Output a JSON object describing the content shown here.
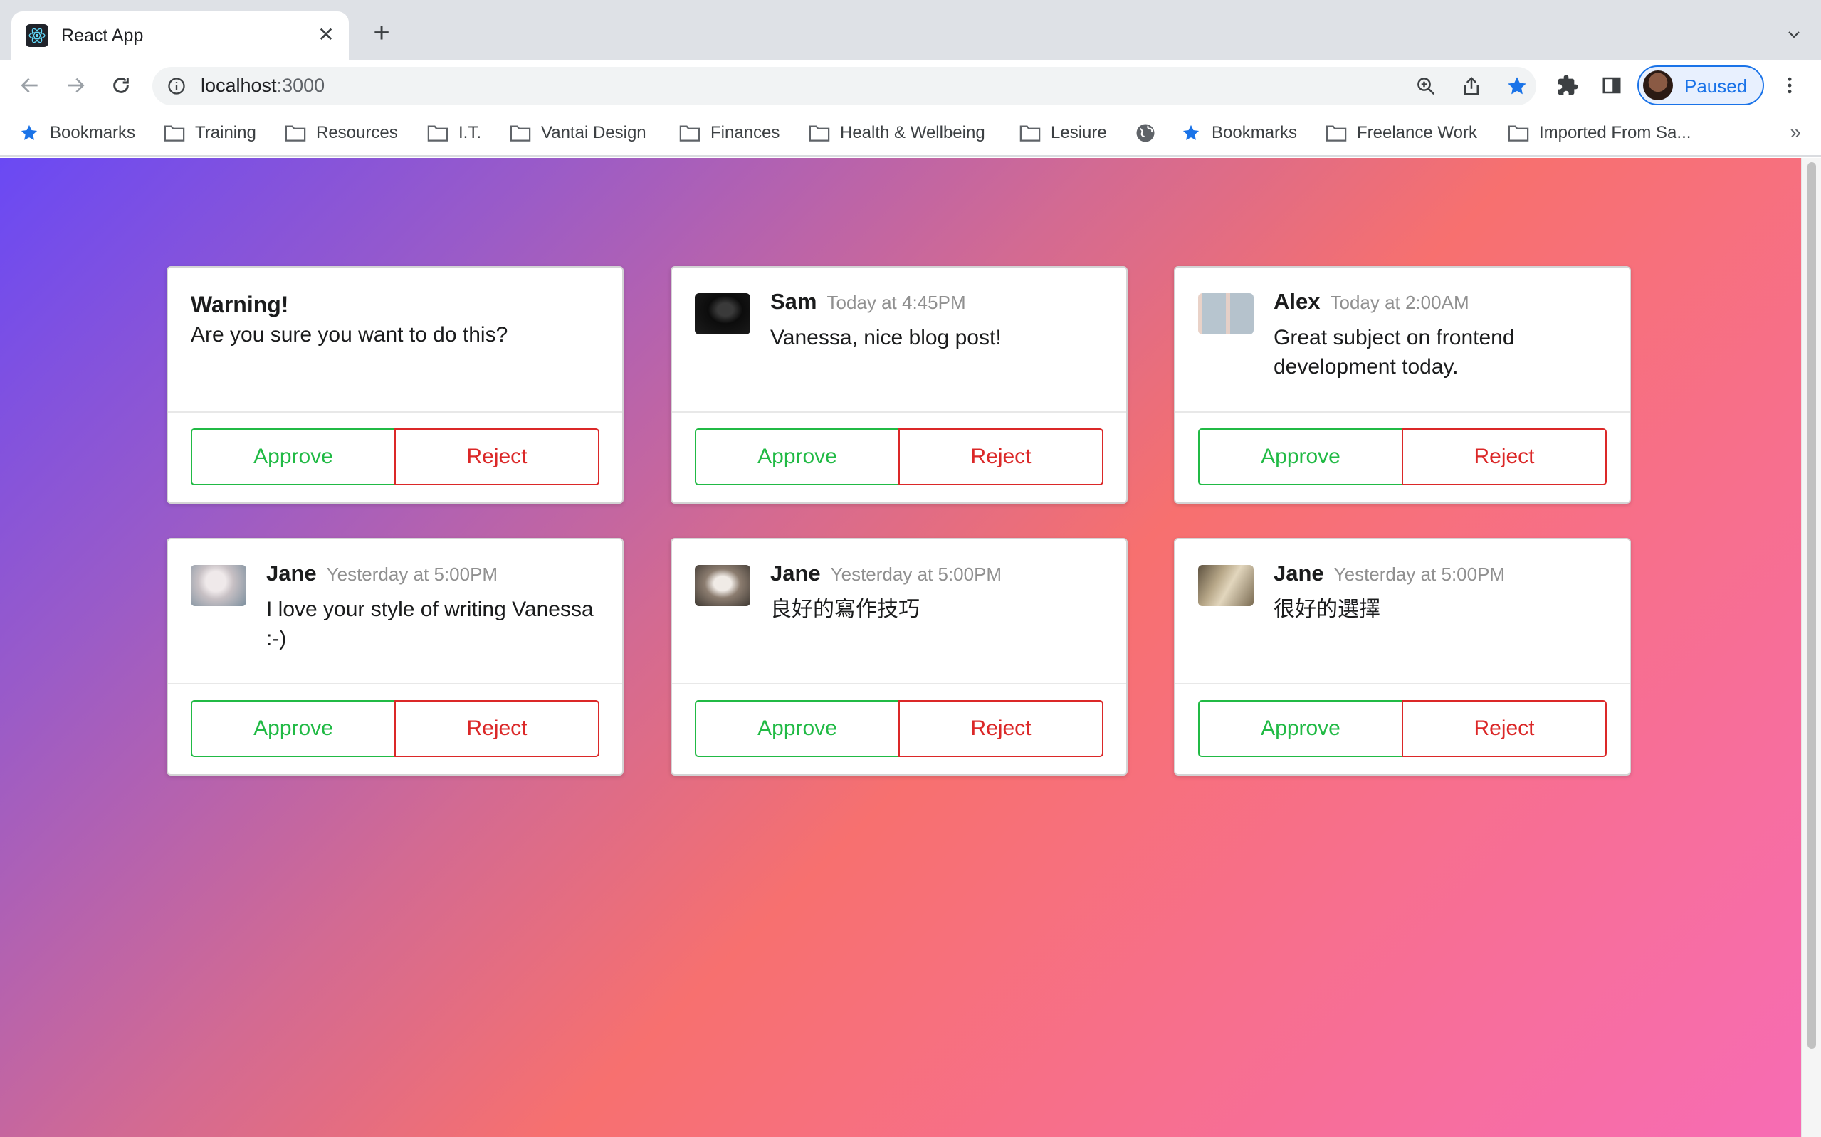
{
  "browser": {
    "tab_title": "React App",
    "url_host": "localhost",
    "url_port": ":3000",
    "profile_label": "Paused",
    "bookmarks": [
      "Bookmarks",
      "Training",
      "Resources",
      "I.T.",
      "Vantai Design",
      "Finances",
      "Health & Wellbeing",
      "Lesiure",
      "",
      "Bookmarks",
      "Freelance Work",
      "Imported From Sa..."
    ],
    "bookmark_icons": [
      "star-icon",
      "folder-icon",
      "folder-icon",
      "folder-icon",
      "folder-icon",
      "folder-icon",
      "folder-icon",
      "folder-icon",
      "globe-icon",
      "star-icon",
      "folder-icon",
      "folder-icon"
    ]
  },
  "warning_card": {
    "title": "Warning!",
    "message": "Are you sure you want to do this?",
    "approve_label": "Approve",
    "reject_label": "Reject"
  },
  "comments": [
    {
      "author": "Sam",
      "date": "Today at 4:45PM",
      "text": "Vanessa, nice blog post!",
      "approve_label": "Approve",
      "reject_label": "Reject"
    },
    {
      "author": "Alex",
      "date": "Today at 2:00AM",
      "text": "Great subject on frontend development today.",
      "approve_label": "Approve",
      "reject_label": "Reject"
    },
    {
      "author": "Jane",
      "date": "Yesterday at 5:00PM",
      "text": "I love your style of writing Vanessa :-)",
      "approve_label": "Approve",
      "reject_label": "Reject"
    },
    {
      "author": "Jane",
      "date": "Yesterday at 5:00PM",
      "text": "良好的寫作技巧",
      "approve_label": "Approve",
      "reject_label": "Reject"
    },
    {
      "author": "Jane",
      "date": "Yesterday at 5:00PM",
      "text": "很好的選擇",
      "approve_label": "Approve",
      "reject_label": "Reject"
    }
  ],
  "colors": {
    "approve": "#21ba45",
    "reject": "#db2828",
    "gradient_start": "#6a49f4",
    "gradient_mid": "#f7706f",
    "gradient_end": "#f76cb4"
  }
}
